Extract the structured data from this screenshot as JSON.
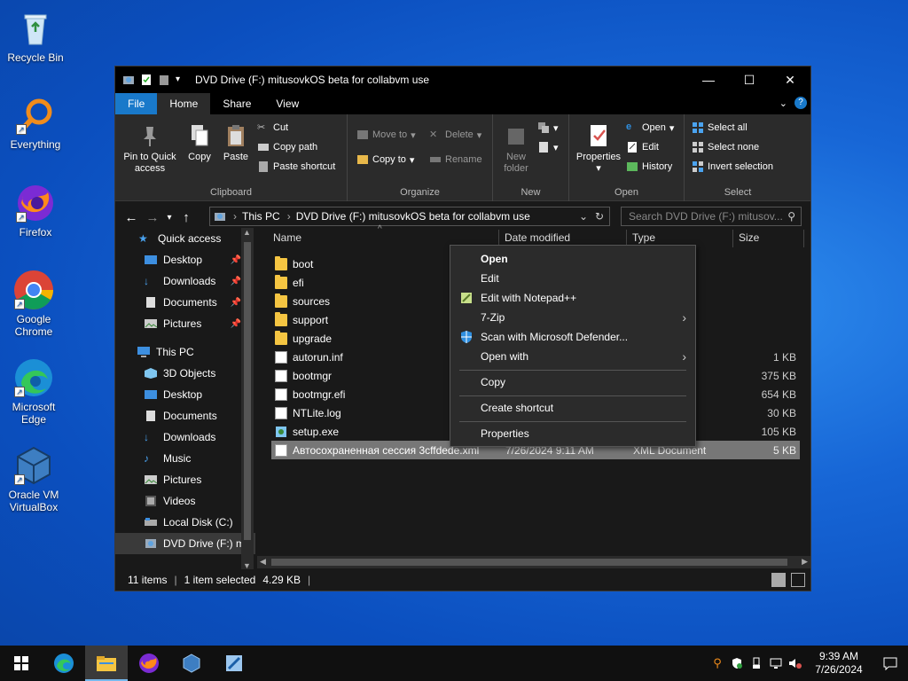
{
  "desktop": {
    "icons": [
      {
        "label": "Recycle Bin",
        "icon": "recycle-bin-icon"
      },
      {
        "label": "Everything",
        "icon": "search-icon"
      },
      {
        "label": "Firefox",
        "icon": "firefox-icon"
      },
      {
        "label": "Google Chrome",
        "icon": "chrome-icon"
      },
      {
        "label": "Microsoft Edge",
        "icon": "edge-icon"
      },
      {
        "label": "Oracle VM VirtualBox",
        "icon": "virtualbox-icon"
      }
    ]
  },
  "window": {
    "title": "DVD Drive (F:) mitusovkOS beta for collabvm use",
    "controls": {
      "minimize": "—",
      "maximize": "☐",
      "close": "✕"
    },
    "tabs": [
      {
        "label": "File"
      },
      {
        "label": "Home"
      },
      {
        "label": "Share"
      },
      {
        "label": "View"
      }
    ],
    "ribbon": {
      "clipboard": {
        "label": "Clipboard",
        "pin": "Pin to Quick access",
        "copy": "Copy",
        "paste": "Paste",
        "cut": "Cut",
        "copy_path": "Copy path",
        "paste_shortcut": "Paste shortcut"
      },
      "organize": {
        "label": "Organize",
        "move_to": "Move to",
        "copy_to": "Copy to",
        "delete": "Delete",
        "rename": "Rename"
      },
      "new": {
        "label": "New",
        "new_folder": "New folder"
      },
      "open": {
        "label": "Open",
        "properties": "Properties",
        "open": "Open",
        "edit": "Edit",
        "history": "History"
      },
      "select": {
        "label": "Select",
        "select_all": "Select all",
        "select_none": "Select none",
        "invert": "Invert selection"
      }
    },
    "address": {
      "crumbs": [
        "This PC",
        "DVD Drive (F:) mitusovkOS beta for collabvm use"
      ],
      "search_placeholder": "Search DVD Drive (F:) mitusov..."
    },
    "nav": {
      "quick_access": "Quick access",
      "quick_items": [
        {
          "label": "Desktop"
        },
        {
          "label": "Downloads"
        },
        {
          "label": "Documents"
        },
        {
          "label": "Pictures"
        }
      ],
      "this_pc": "This PC",
      "pc_items": [
        {
          "label": "3D Objects"
        },
        {
          "label": "Desktop"
        },
        {
          "label": "Documents"
        },
        {
          "label": "Downloads"
        },
        {
          "label": "Music"
        },
        {
          "label": "Pictures"
        },
        {
          "label": "Videos"
        },
        {
          "label": "Local Disk (C:)"
        },
        {
          "label": "DVD Drive (F:) m"
        }
      ]
    },
    "columns": {
      "name": "Name",
      "date": "Date modified",
      "type": "Type",
      "size": "Size"
    },
    "files": [
      {
        "name": "boot",
        "date": "",
        "type": "",
        "size": "",
        "kind": "folder"
      },
      {
        "name": "efi",
        "date": "",
        "type": "",
        "size": "",
        "kind": "folder"
      },
      {
        "name": "sources",
        "date": "",
        "type": "",
        "size": "",
        "kind": "folder"
      },
      {
        "name": "support",
        "date": "",
        "type": "",
        "size": "",
        "kind": "folder"
      },
      {
        "name": "upgrade",
        "date": "",
        "type": "",
        "size": "",
        "kind": "folder"
      },
      {
        "name": "autorun.inf",
        "date": "",
        "type": "tion",
        "size": "1 KB",
        "kind": "file"
      },
      {
        "name": "bootmgr",
        "date": "",
        "type": "",
        "size": "375 KB",
        "kind": "file"
      },
      {
        "name": "bootmgr.efi",
        "date": "",
        "type": "",
        "size": "654 KB",
        "kind": "file"
      },
      {
        "name": "NTLite.log",
        "date": "",
        "type": "nt",
        "size": "30 KB",
        "kind": "file"
      },
      {
        "name": "setup.exe",
        "date": "",
        "type": "",
        "size": "105 KB",
        "kind": "exe"
      },
      {
        "name": "Автосохраненная сессия 3cffdede.xml",
        "date": "7/26/2024 9:11 AM",
        "type": "XML Document",
        "size": "5 KB",
        "kind": "xml"
      }
    ],
    "status": {
      "count": "11 items",
      "selected": "1 item selected",
      "size": "4.29 KB"
    }
  },
  "context_menu": {
    "items": [
      {
        "label": "Open",
        "bold": true
      },
      {
        "label": "Edit"
      },
      {
        "label": "Edit with Notepad++"
      },
      {
        "label": "7-Zip"
      },
      {
        "label": "Scan with Microsoft Defender..."
      },
      {
        "label": "Open with"
      },
      {
        "label": "Copy"
      },
      {
        "label": "Create shortcut"
      },
      {
        "label": "Properties"
      }
    ]
  },
  "taskbar": {
    "time": "9:39 AM",
    "date": "7/26/2024"
  }
}
